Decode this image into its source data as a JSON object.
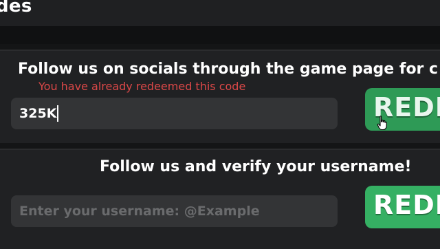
{
  "header": {
    "title": "des"
  },
  "redeem_panel": {
    "title": "Follow us on socials through the game page for c",
    "error": "You have already redeemed this code",
    "code_value": "325K",
    "button_label": "REDE"
  },
  "verify_panel": {
    "title": "Follow us and verify your username!",
    "username_placeholder": "Enter your username: @Example",
    "button_label": "REDE"
  },
  "colors": {
    "accent_green": "#35b063",
    "error_red": "#dc4848",
    "panel_bg": "#202123",
    "input_bg": "#333436"
  },
  "icons": {
    "cursor": "hand-pointer-icon"
  }
}
